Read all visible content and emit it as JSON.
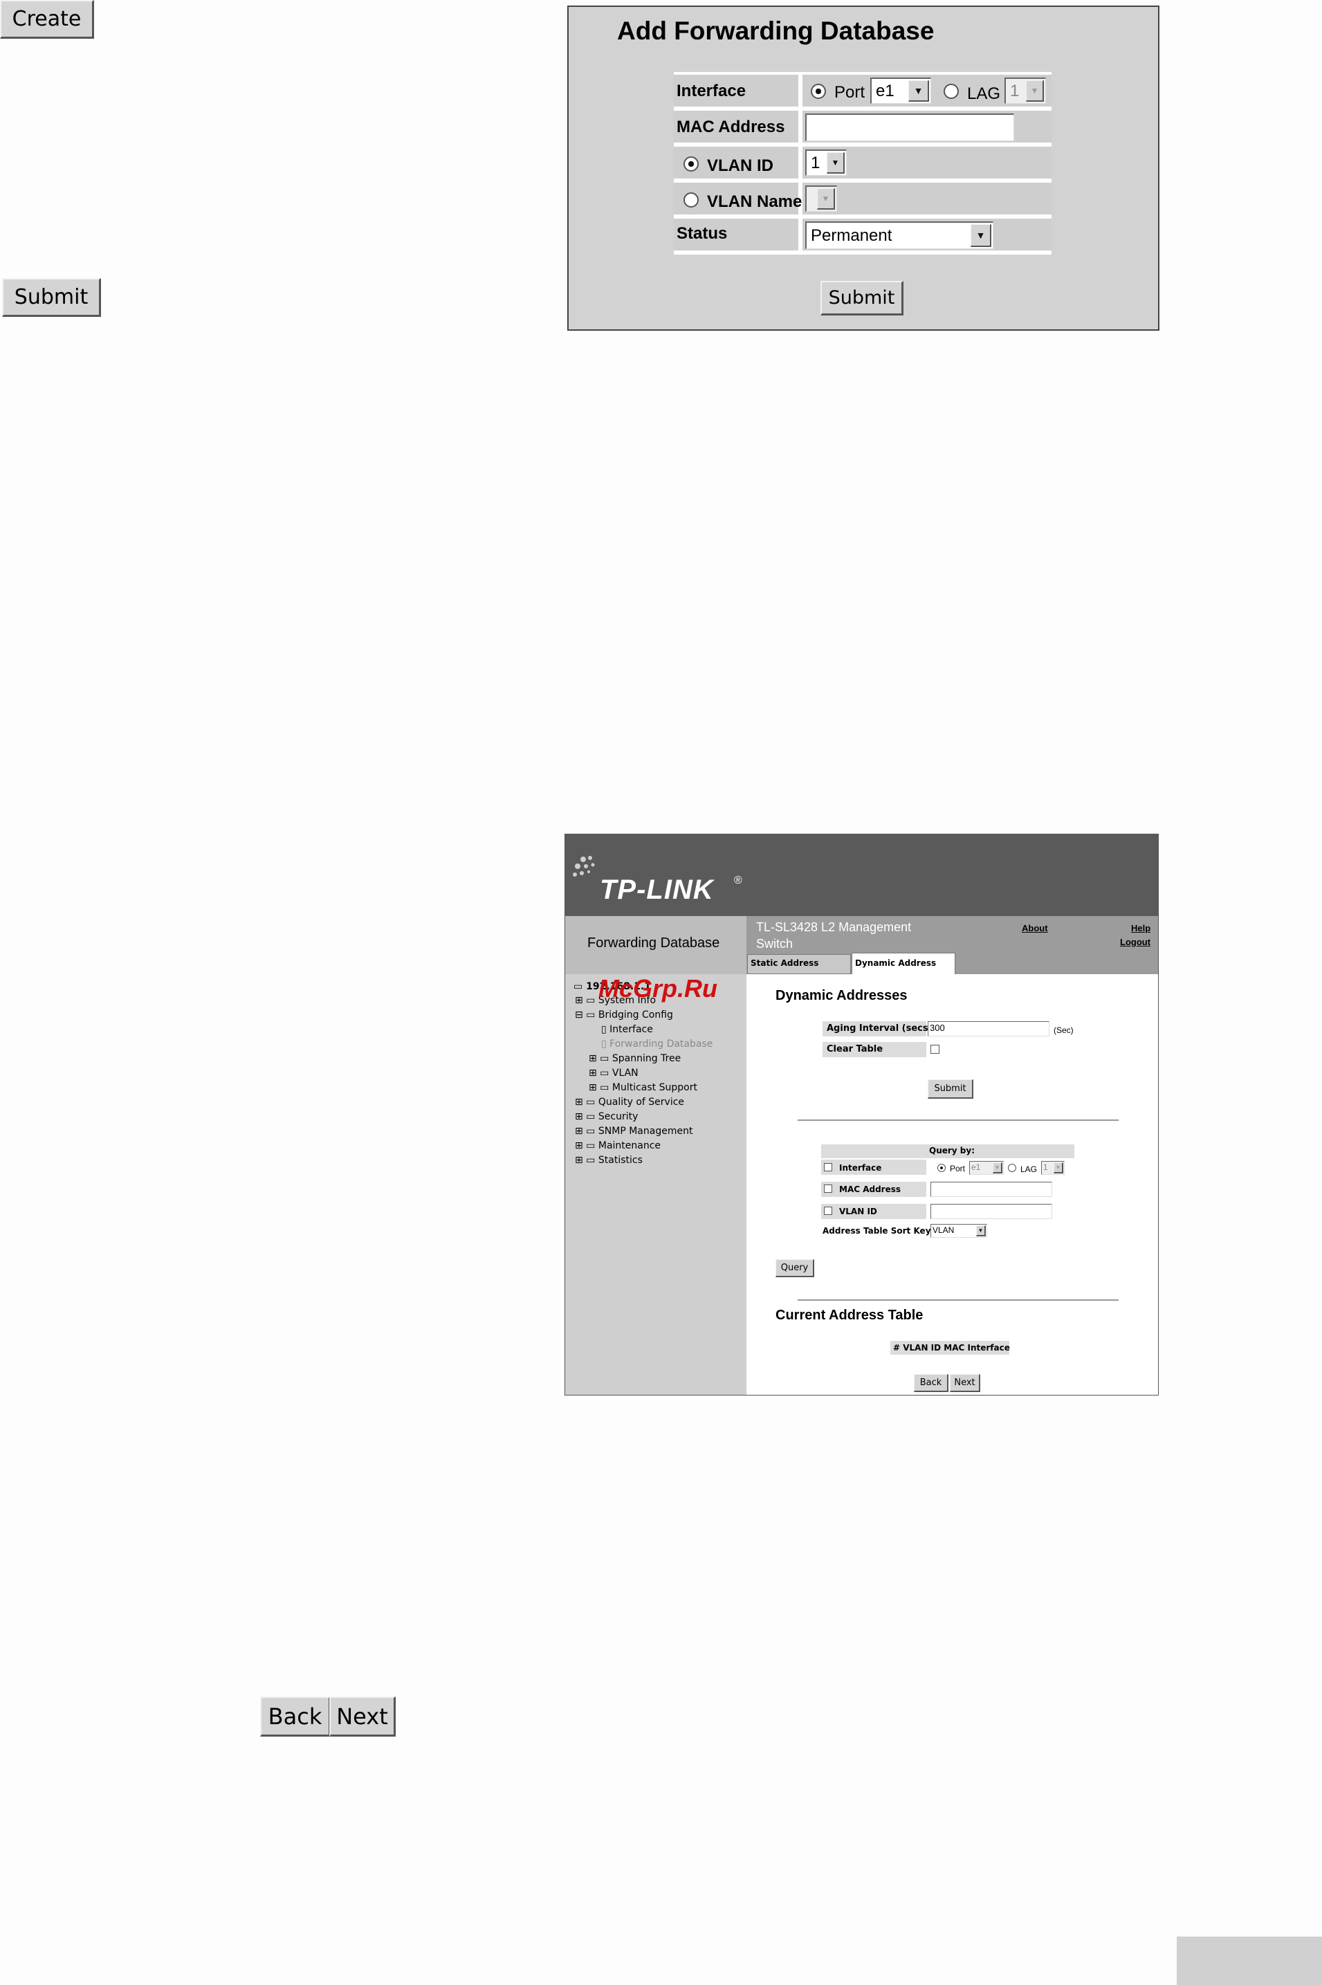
{
  "standalone": {
    "create_label": "Create",
    "submit_label": "Submit",
    "back_label": "Back",
    "next_label": "Next"
  },
  "dialog": {
    "title": "Add Forwarding Database",
    "interface_label": "Interface",
    "port_label": "Port",
    "port_value": "e1",
    "lag_label": "LAG",
    "lag_value": "1",
    "mac_label": "MAC Address",
    "mac_value": "",
    "vlan_id_label": "VLAN ID",
    "vlan_id_value": "1",
    "vlan_name_label": "VLAN Name",
    "vlan_name_value": "",
    "status_label": "Status",
    "status_value": "Permanent",
    "submit_label": "Submit"
  },
  "screenshot": {
    "logo_text": "TP-LINK",
    "logo_mark": "®",
    "page_label": "Forwarding Database",
    "device_title": "TL-SL3428 L2 Management Switch",
    "links": {
      "about": "About",
      "help": "Help",
      "logout": "Logout"
    },
    "tabs": [
      "Static Address",
      "Dynamic Address"
    ],
    "watermark": "McGrp.Ru",
    "tree": {
      "root": "192.168.1.1",
      "items": [
        {
          "label": "System Info",
          "level": 1
        },
        {
          "label": "Bridging Config",
          "level": 1
        },
        {
          "label": "Interface",
          "level": 2
        },
        {
          "label": "Forwarding Database",
          "level": 2
        },
        {
          "label": "Spanning Tree",
          "level": 2
        },
        {
          "label": "VLAN",
          "level": 2
        },
        {
          "label": "Multicast Support",
          "level": 2
        },
        {
          "label": "Quality of Service",
          "level": 1
        },
        {
          "label": "Security",
          "level": 1
        },
        {
          "label": "SNMP Management",
          "level": 1
        },
        {
          "label": "Maintenance",
          "level": 1
        },
        {
          "label": "Statistics",
          "level": 1
        }
      ]
    },
    "dynamic": {
      "heading": "Dynamic Addresses",
      "aging_label": "Aging Interval (secs)",
      "aging_value": "300",
      "aging_unit": "(Sec)",
      "clear_label": "Clear Table",
      "submit_label": "Submit"
    },
    "query": {
      "heading": "Query by:",
      "interface_label": "Interface",
      "port_label": "Port",
      "port_value": "e1",
      "lag_label": "LAG",
      "lag_value": "1",
      "mac_label": "MAC Address",
      "vlan_label": "VLAN ID",
      "sort_label": "Address Table Sort Key",
      "sort_value": "VLAN",
      "query_label": "Query"
    },
    "current": {
      "heading": "Current Address Table",
      "columns": "# VLAN ID MAC Interface",
      "back_label": "Back",
      "next_label": "Next"
    }
  }
}
